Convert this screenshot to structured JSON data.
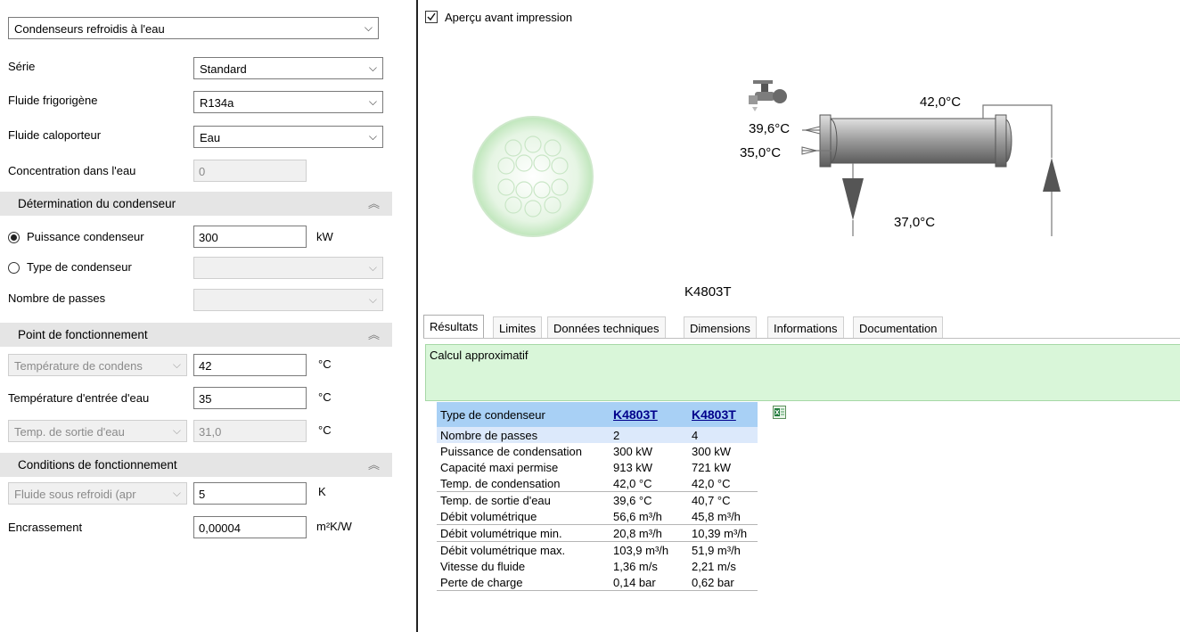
{
  "left": {
    "product_type": "Condenseurs refroidis à l'eau",
    "serie": {
      "label": "Série",
      "value": "Standard"
    },
    "refrigerant": {
      "label": "Fluide frigorigène",
      "value": "R134a"
    },
    "coolant": {
      "label": "Fluide caloporteur",
      "value": "Eau"
    },
    "concentration": {
      "label": "Concentration dans l'eau",
      "value": "0"
    },
    "section_determination": "Détermination du condenseur",
    "radio_power": {
      "label": "Puissance condenseur",
      "value": "300",
      "unit": "kW",
      "selected": true
    },
    "radio_type": {
      "label": "Type de condenseur",
      "value": "",
      "selected": false
    },
    "passes": {
      "label": "Nombre de passes",
      "value": ""
    },
    "section_point": "Point de fonctionnement",
    "cond_temp": {
      "label": "Température de condens",
      "value": "42",
      "unit": "°C"
    },
    "water_in": {
      "label": "Température d'entrée d'eau",
      "value": "35",
      "unit": "°C"
    },
    "water_out": {
      "label": "Temp. de sortie d'eau",
      "value": "31,0",
      "unit": "°C"
    },
    "section_conditions": "Conditions de fonctionnement",
    "subcool": {
      "label": "Fluide sous refroidi (apr",
      "value": "5",
      "unit": "K"
    },
    "fouling": {
      "label": "Encrassement",
      "value": "0,00004",
      "unit": "m²K/W"
    }
  },
  "preview": {
    "checkbox_label": "Aperçu avant impression",
    "checked": true,
    "temp_cond": "42,0°C",
    "temp_out": "39,6°C",
    "temp_in": "35,0°C",
    "temp_liquid": "37,0°C",
    "model": "K4803T"
  },
  "tabs": [
    "Résultats",
    "Limites",
    "Données techniques",
    "Dimensions",
    "Informations",
    "Documentation"
  ],
  "active_tab": 0,
  "message": "Calcul approximatif",
  "results": {
    "header": {
      "label": "Type de condenseur",
      "col1": "K4803T",
      "col2": "K4803T"
    },
    "rows": [
      {
        "label": "Nombre de passes",
        "col1": "2",
        "col2": "4"
      },
      {
        "label": "Puissance de condensation",
        "col1": "300  kW",
        "col2": "300  kW"
      },
      {
        "label": "Capacité maxi permise",
        "col1": "913  kW",
        "col2": "721  kW"
      },
      {
        "label": "Temp. de condensation",
        "col1": "42,0  °C",
        "col2": "42,0  °C"
      },
      {
        "label": "Temp. de sortie d'eau",
        "col1": "39,6  °C",
        "col2": "40,7  °C"
      },
      {
        "label": "Débit volumétrique",
        "col1": "56,6  m³/h",
        "col2": "45,8  m³/h"
      },
      {
        "label": "Débit volumétrique min.",
        "col1": "20,8  m³/h",
        "col2": "10,39  m³/h"
      },
      {
        "label": "Débit volumétrique max.",
        "col1": "103,9  m³/h",
        "col2": "51,9  m³/h"
      },
      {
        "label": "Vitesse du fluide",
        "col1": "1,36  m/s",
        "col2": "2,21  m/s"
      },
      {
        "label": "Perte de charge",
        "col1": "0,14  bar",
        "col2": "0,62  bar"
      }
    ]
  }
}
